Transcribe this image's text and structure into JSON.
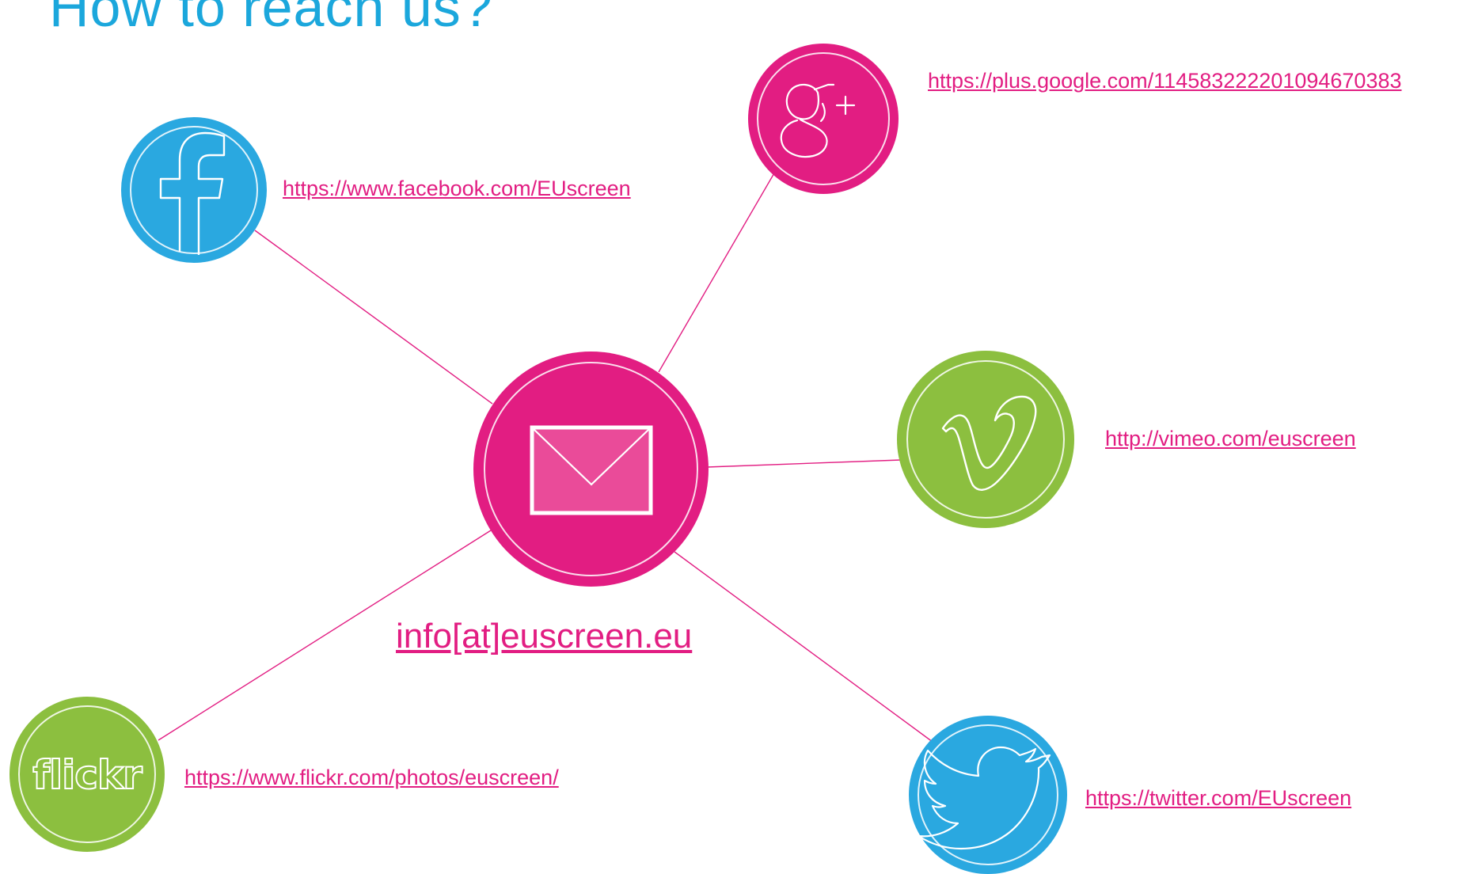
{
  "title": "How to reach us?",
  "colors": {
    "title": "#1ba7dc",
    "pink": "#e21d82",
    "blue": "#2aa8e0",
    "green": "#8cbf3f",
    "link": "#e21d82",
    "line": "#e21d82"
  },
  "center": {
    "icon": "envelope-icon",
    "link": "info[at]euscreen.eu"
  },
  "networks": [
    {
      "name": "google-plus",
      "icon": "google-plus-icon",
      "color": "pink",
      "link": "https://plus.google.com/114583222201094670383"
    },
    {
      "name": "facebook",
      "icon": "facebook-icon",
      "color": "blue",
      "link": "https://www.facebook.com/EUscreen"
    },
    {
      "name": "vimeo",
      "icon": "vimeo-icon",
      "color": "green",
      "link": "http://vimeo.com/euscreen"
    },
    {
      "name": "flickr",
      "icon": "flickr-icon",
      "icon_text": "flickr",
      "color": "green",
      "link": "https://www.flickr.com/photos/euscreen/"
    },
    {
      "name": "twitter",
      "icon": "twitter-icon",
      "color": "blue",
      "link": "https://twitter.com/EUscreen"
    }
  ]
}
